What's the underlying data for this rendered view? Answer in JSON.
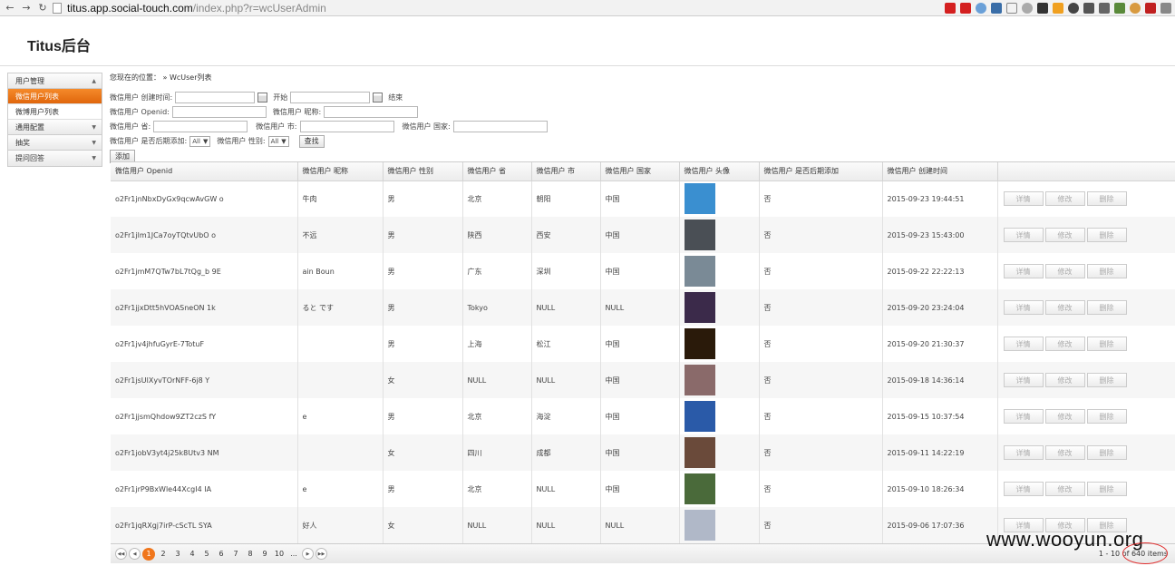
{
  "browser": {
    "url_host": "titus.app.social-touch.com",
    "url_path": "/index.php?r=wcUserAdmin"
  },
  "app": {
    "title": "Titus后台"
  },
  "sidebar": {
    "sections": [
      {
        "label": "用户管理",
        "items": [
          "微信用户列表",
          "微博用户列表"
        ]
      },
      {
        "label": "通用配置",
        "items": []
      },
      {
        "label": "抽奖",
        "items": []
      },
      {
        "label": "提问回答",
        "items": []
      }
    ]
  },
  "breadcrumb": {
    "text": "您现在的位置： » WcUser列表"
  },
  "filters": {
    "created_label": "微信用户 创建时间:",
    "start_label": "开始",
    "end_label": "结束",
    "openid_label": "微信用户 Openid:",
    "nickname_label": "微信用户 昵称:",
    "province_label": "微信用户 省:",
    "city_label": "微信用户 市:",
    "country_label": "微信用户 国家:",
    "late_label": "微信用户 是否后期添加:",
    "late_value": "All",
    "gender_label": "微信用户 性别:",
    "gender_value": "All",
    "search_label": "查找",
    "add_label": "添加"
  },
  "table": {
    "columns": [
      "微信用户 Openid",
      "微信用户 昵称",
      "微信用户 性别",
      "微信用户 省",
      "微信用户 市",
      "微信用户 国家",
      "微信用户 头像",
      "微信用户 是否后期添加",
      "微信用户 创建时间",
      ""
    ],
    "actions": {
      "detail": "详情",
      "edit": "修改",
      "delete": "删除"
    },
    "rows": [
      {
        "openid": "o2Fr1jnNbxDyGx9qcwAvGW o",
        "nickname": "牛肉",
        "gender": "男",
        "province": "北京",
        "city": "朝阳",
        "country": "中国",
        "avatar_color": "#3a8fd0",
        "late": "否",
        "created": "2015-09-23 19:44:51"
      },
      {
        "openid": "o2Fr1jlm1JCa7oyTQtvUbO o",
        "nickname": "不远",
        "gender": "男",
        "province": "陕西",
        "city": "西安",
        "country": "中国",
        "avatar_color": "#4a4f55",
        "late": "否",
        "created": "2015-09-23 15:43:00"
      },
      {
        "openid": "o2Fr1jmM7QTw7bL7tQg_b 9E",
        "nickname": "ain Boun",
        "gender": "男",
        "province": "广东",
        "city": "深圳",
        "country": "中国",
        "avatar_color": "#7a8a96",
        "late": "否",
        "created": "2015-09-22 22:22:13"
      },
      {
        "openid": "o2Fr1jjxDtt5hVOASneON 1k",
        "nickname": "ると です",
        "gender": "男",
        "province": "Tokyo",
        "city": "NULL",
        "country": "NULL",
        "avatar_color": "#3b2a4a",
        "late": "否",
        "created": "2015-09-20 23:24:04"
      },
      {
        "openid": "o2Fr1jv4jhfuGyrE-7TotuF",
        "nickname": "",
        "gender": "男",
        "province": "上海",
        "city": "松江",
        "country": "中国",
        "avatar_color": "#2a1a0a",
        "late": "否",
        "created": "2015-09-20 21:30:37"
      },
      {
        "openid": "o2Fr1jsUlXyvTOrNFF-6j8 Y",
        "nickname": "",
        "gender": "女",
        "province": "NULL",
        "city": "NULL",
        "country": "中国",
        "avatar_color": "#8a6a6a",
        "late": "否",
        "created": "2015-09-18 14:36:14"
      },
      {
        "openid": "o2Fr1jjsmQhdow9ZT2czS fY",
        "nickname": "e",
        "gender": "男",
        "province": "北京",
        "city": "海淀",
        "country": "中国",
        "avatar_color": "#2a5aa8",
        "late": "否",
        "created": "2015-09-15 10:37:54"
      },
      {
        "openid": "o2Fr1jobV3yt4j25k8Utv3 NM",
        "nickname": "",
        "gender": "女",
        "province": "四川",
        "city": "成都",
        "country": "中国",
        "avatar_color": "#6a4a3a",
        "late": "否",
        "created": "2015-09-11 14:22:19"
      },
      {
        "openid": "o2Fr1jrP9BxWle44XcgI4 IA",
        "nickname": "e",
        "gender": "男",
        "province": "北京",
        "city": "NULL",
        "country": "中国",
        "avatar_color": "#4a6a3a",
        "late": "否",
        "created": "2015-09-10 18:26:34"
      },
      {
        "openid": "o2Fr1jqRXgj7irP-cScTL SYA",
        "nickname": "好人",
        "gender": "女",
        "province": "NULL",
        "city": "NULL",
        "country": "NULL",
        "avatar_color": "#b0b8c8",
        "late": "否",
        "created": "2015-09-06 17:07:36"
      }
    ]
  },
  "pager": {
    "pages": [
      "1",
      "2",
      "3",
      "4",
      "5",
      "6",
      "7",
      "8",
      "9",
      "10",
      "..."
    ],
    "current": "1",
    "info": "1 - 10 of 640 items"
  },
  "watermark": "www.wooyun.org"
}
